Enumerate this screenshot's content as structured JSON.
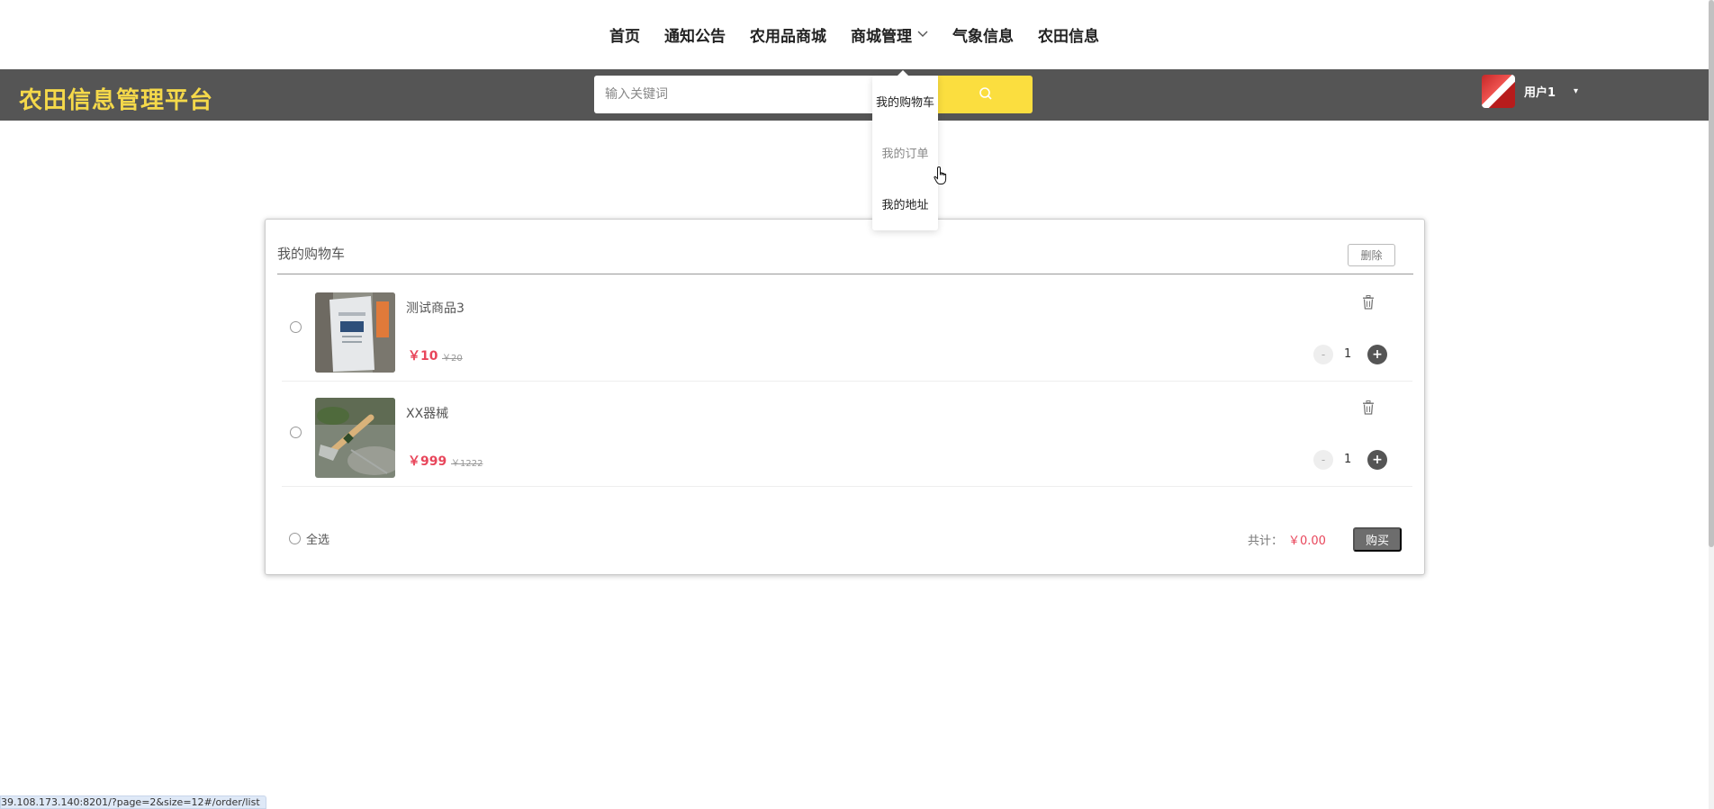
{
  "nav": {
    "items": [
      {
        "label": "首页"
      },
      {
        "label": "通知公告"
      },
      {
        "label": "农用品商城"
      },
      {
        "label": "商城管理"
      },
      {
        "label": "气象信息"
      },
      {
        "label": "农田信息"
      }
    ]
  },
  "header": {
    "brand": "农田信息管理平台",
    "search_placeholder": "输入关键词",
    "user_name": "用户1"
  },
  "dropdown": {
    "items": [
      {
        "label": "我的购物车"
      },
      {
        "label": "我的订单"
      },
      {
        "label": "我的地址"
      }
    ]
  },
  "cart": {
    "title": "我的购物车",
    "delete_label": "删除",
    "items": [
      {
        "name": "测试商品3",
        "price": "￥10",
        "old_price": "￥20",
        "quantity": "1",
        "minus": "-",
        "plus": "+"
      },
      {
        "name": "XX器械",
        "price": "￥999",
        "old_price": "￥1222",
        "quantity": "1",
        "minus": "-",
        "plus": "+"
      }
    ],
    "select_all_label": "全选",
    "total_label": "共计：",
    "total_value": "￥0.00",
    "buy_label": "购买"
  },
  "status_bar": {
    "url": "39.108.173.140:8201/?page=2&size=12#/order/list"
  },
  "colors": {
    "accent_yellow": "#fbde3f",
    "brand_text": "#f5d94a",
    "header_bg": "#555555",
    "price_red": "#e8465b"
  }
}
